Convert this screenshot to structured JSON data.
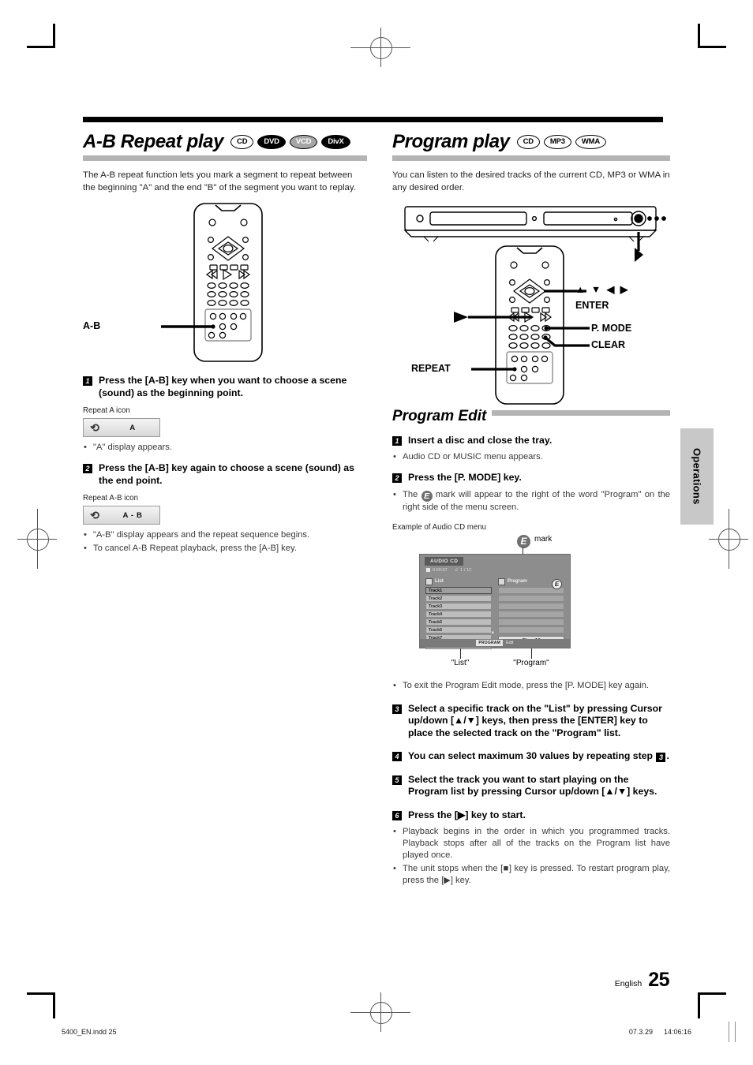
{
  "page": {
    "language": "English",
    "number": "25",
    "side_tab": "Operations",
    "print_file": "5400_EN.indd   25",
    "print_date": "07.3.29",
    "print_time": "14:06:16"
  },
  "left": {
    "title": "A-B Repeat play",
    "badges": [
      {
        "label": "CD",
        "style": "outline"
      },
      {
        "label": "DVD",
        "style": "black"
      },
      {
        "label": "VCD",
        "style": "gray"
      },
      {
        "label": "DivX",
        "style": "black"
      }
    ],
    "intro": "The A-B repeat function lets you mark a segment to repeat between the beginning \"A\" and the end \"B\" of the segment you want to replay.",
    "remote_callout": "A-B",
    "steps": [
      {
        "num": "1",
        "text": "Press the [A-B] key when you want to choose a scene (sound) as the beginning point.",
        "caption": "Repeat A icon",
        "chip_icon": "repeat-arrow-icon",
        "chip_label": "A",
        "bullets": [
          "\"A\" display appears."
        ]
      },
      {
        "num": "2",
        "text": "Press the [A-B] key again to choose a scene (sound) as the end point.",
        "caption": "Repeat A-B icon",
        "chip_icon": "repeat-arrow-icon",
        "chip_label": "A - B",
        "bullets": [
          "\"A-B\" display appears and the repeat sequence begins.",
          "To cancel A-B Repeat playback, press the [A-B] key."
        ]
      }
    ]
  },
  "right": {
    "title": "Program play",
    "badges": [
      {
        "label": "CD",
        "style": "outline"
      },
      {
        "label": "MP3",
        "style": "outline"
      },
      {
        "label": "WMA",
        "style": "outline"
      }
    ],
    "intro": "You can listen to the desired tracks of the current CD, MP3 or WMA in any desired order.",
    "diagram_labels": {
      "cursor": "▲  ▼  ◀  ▶",
      "enter": "ENTER",
      "p_mode": "P. MODE",
      "clear": "CLEAR",
      "repeat": "REPEAT",
      "play_arrow": "▶"
    },
    "subtitle": "Program Edit",
    "steps": [
      {
        "num": "1",
        "text": "Insert a disc and close the tray.",
        "bullets": [
          "Audio CD or MUSIC menu appears."
        ]
      },
      {
        "num": "2",
        "text": "Press the [P. MODE] key.",
        "bullets_html": [
          "The  E  mark will appear to the right of the word \"Program\" on the right side of the menu screen."
        ]
      },
      {
        "num": "3",
        "text": "Select a specific track on the \"List\" by pressing Cursor up/down [▲/▼] keys, then press the [ENTER] key to place the selected track on the \"Program\" list."
      },
      {
        "num": "4",
        "text_before": "You can select maximum 30 values by repeating step ",
        "step_ref": "3",
        "text_after": "."
      },
      {
        "num": "5",
        "text": "Select the track you want to start playing on the Program list by pressing Cursor up/down [▲/▼] keys."
      },
      {
        "num": "6",
        "text": "Press the [▶] key to start.",
        "bullets": [
          "Playback begins in the order in which you programmed tracks. Playback stops after all of the tracks on the Program list have played once.",
          "The unit stops when the [■] key is pressed. To restart program play, press the [▶] key."
        ]
      }
    ],
    "exit_note": "To exit the Program Edit mode, press the [P. MODE] key again.",
    "example_caption": "Example of Audio CD menu",
    "emark_caption": "mark",
    "emark_letter": "E",
    "osd": {
      "disc_type": "AUDIO CD",
      "time": "0:00:07",
      "track_count": "1 / 12",
      "list_header": "List",
      "program_header": "Program",
      "emark": "E",
      "tracks": [
        "Track1",
        "Track2",
        "Track3",
        "Track4",
        "Track5",
        "Track6",
        "Track7",
        "Track8"
      ],
      "program_slots": [
        "",
        "",
        "",
        "",
        "",
        ""
      ],
      "clear_all": "Clear All",
      "footer_key": "PROGRAM",
      "footer_label": "Edit",
      "scroll_down": "▼"
    },
    "leader_labels": {
      "list": "\"List\"",
      "program": "\"Program\""
    }
  }
}
